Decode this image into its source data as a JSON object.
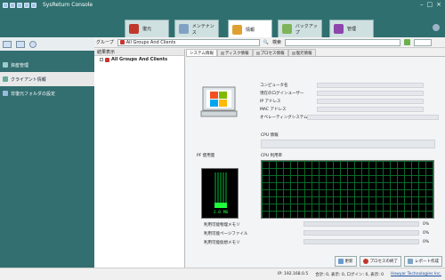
{
  "window": {
    "title": "SysReturn Console"
  },
  "tabs": [
    {
      "label": "復元",
      "icon": "restore-icon",
      "color": "#c0392b"
    },
    {
      "label": "メンテナンス",
      "icon": "maintenance-icon",
      "color": "#7fa2c4"
    },
    {
      "label": "情報",
      "icon": "info-icon",
      "color": "#e0a030"
    },
    {
      "label": "バックアップ",
      "icon": "backup-icon",
      "color": "#7fb35a"
    },
    {
      "label": "管理",
      "icon": "manage-icon",
      "color": "#8e44ad"
    }
  ],
  "sidebar": {
    "items": [
      {
        "label": "資産管理",
        "icon": "asset-icon",
        "active": false
      },
      {
        "label": "クライアント情報",
        "icon": "client-icon",
        "active": true
      },
      {
        "label": "非復元フォルダの設定",
        "icon": "folder-icon",
        "active": false
      }
    ]
  },
  "toolbar": {
    "group_label": "グループ",
    "group_value": "All Groups And Clients",
    "search_label": "検索",
    "search_placeholder": ""
  },
  "tree": {
    "header": "結果表示",
    "root_item": "All Groups And Clients"
  },
  "subtabs": [
    "システム情報",
    "ディスク情報",
    "プロセス情報",
    "復元情報"
  ],
  "system_info": {
    "labels": [
      "コンピュータ名",
      "現在のログインユーザー",
      "IP アドレス",
      "MAC アドレス",
      "オペレーティングシステム"
    ],
    "cpu_info_label": "CPU 情報"
  },
  "pf": {
    "label": "PF 使用量",
    "readout": "2.0 MB"
  },
  "cpu_usage_label": "CPU 利用率",
  "memory": [
    {
      "label": "利用可能物理メモリ",
      "percent": "0%"
    },
    {
      "label": "利用可能ページファイル",
      "percent": "0%"
    },
    {
      "label": "利用可能仮想メモリ",
      "percent": "0%"
    }
  ],
  "bottom_buttons": [
    {
      "label": "更新",
      "icon": "refresh-icon"
    },
    {
      "label": "プロセスの終了",
      "icon": "stop-icon"
    },
    {
      "label": "レポート作成",
      "icon": "report-icon"
    }
  ],
  "status": {
    "ip": "IP: 192.168.0.5",
    "counts": "合計: 0, 表示: 0, ログイン: 0, 表示: 0",
    "company": "Howyar Technologies Inc."
  }
}
